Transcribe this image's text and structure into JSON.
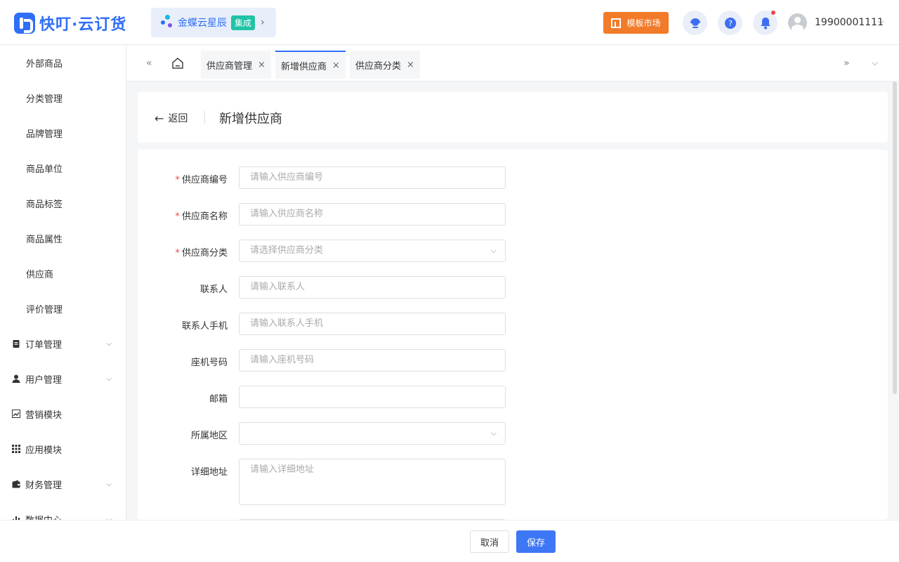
{
  "app": {
    "logo_text": "快叮·云订货"
  },
  "brand_chip": {
    "name": "金蝶云星辰",
    "badge": "集成",
    "arrow": "›"
  },
  "header": {
    "market_label": "模板市场",
    "user_phone": "19900001111",
    "caret": "⌵"
  },
  "sidebar": {
    "sub_items": [
      "外部商品",
      "分类管理",
      "品牌管理",
      "商品单位",
      "商品标签",
      "商品属性",
      "供应商",
      "评价管理"
    ],
    "groups": [
      "订单管理",
      "用户管理",
      "营销模块",
      "应用模块",
      "财务管理",
      "数据中心"
    ]
  },
  "tabs": [
    {
      "label": "供应商管理",
      "close": "×"
    },
    {
      "label": "新增供应商",
      "close": "×"
    },
    {
      "label": "供应商分类",
      "close": "×"
    }
  ],
  "page": {
    "back_label": "返回",
    "title": "新增供应商"
  },
  "form": {
    "fields": [
      {
        "label": "供应商编号",
        "required": "*",
        "placeholder": "请输入供应商编号"
      },
      {
        "label": "供应商名称",
        "required": "*",
        "placeholder": "请输入供应商名称"
      },
      {
        "label": "供应商分类",
        "required": "*",
        "placeholder": "请选择供应商分类"
      },
      {
        "label": "联系人",
        "placeholder": "请输入联系人"
      },
      {
        "label": "联系人手机",
        "placeholder": "请输入联系人手机"
      },
      {
        "label": "座机号码",
        "placeholder": "请输入座机号码"
      },
      {
        "label": "邮箱",
        "placeholder": ""
      },
      {
        "label": "所属地区",
        "placeholder": ""
      },
      {
        "label": "详细地址",
        "placeholder": "请输入详细地址"
      }
    ]
  },
  "footer": {
    "cancel_label": "取消",
    "save_label": "保存"
  }
}
